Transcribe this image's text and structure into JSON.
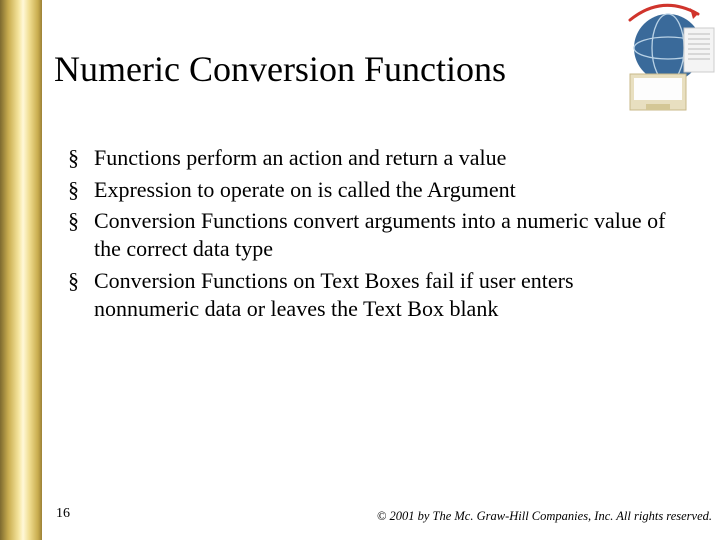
{
  "slide": {
    "title": "Numeric Conversion Functions",
    "bullets": [
      "Functions perform an action and return a value",
      "Expression to operate on is called the Argument",
      "Conversion Functions convert arguments into a numeric value of the correct data type",
      "Conversion Functions on Text Boxes fail if user enters nonnumeric data or leaves the Text Box blank"
    ],
    "page_number": "16",
    "copyright": "© 2001 by The Mc. Graw-Hill Companies, Inc. All rights reserved."
  }
}
